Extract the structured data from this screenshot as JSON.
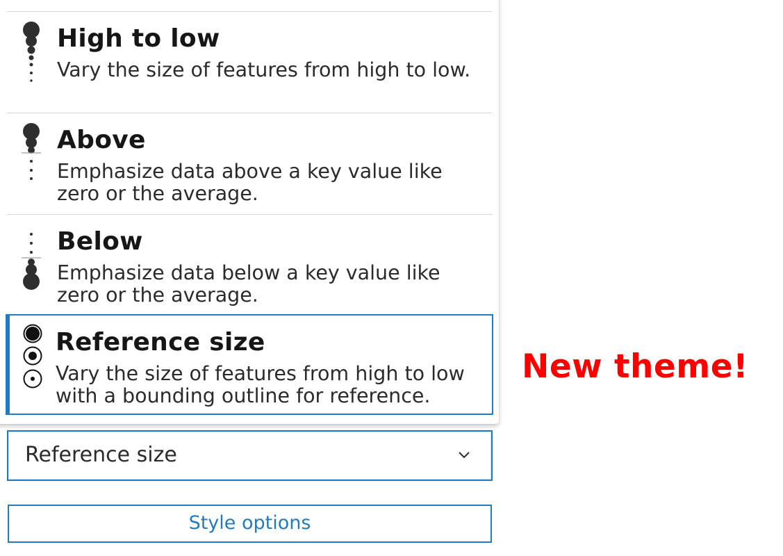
{
  "options": [
    {
      "title": "High to low",
      "description": "Vary the size of features from high to low.",
      "icon": "size-high-to-low-icon"
    },
    {
      "title": "Above",
      "description": "Emphasize data above a key value like zero or the average.",
      "icon": "size-above-icon"
    },
    {
      "title": "Below",
      "description": "Emphasize data below a key value like zero or the average.",
      "icon": "size-below-icon"
    },
    {
      "title": "Reference size",
      "description": "Vary the size of features from high to low with a bounding outline for reference.",
      "icon": "size-reference-icon",
      "selected": true
    }
  ],
  "select": {
    "value": "Reference size",
    "icon": "chevron-down-icon"
  },
  "style_options_button": {
    "label": "Style options"
  },
  "annotation": {
    "text": "New theme!",
    "color": "#ff0000"
  },
  "colors": {
    "accent": "#1f7cc0",
    "icon": "#2f2f2f",
    "divider": "#d6d6d6"
  }
}
